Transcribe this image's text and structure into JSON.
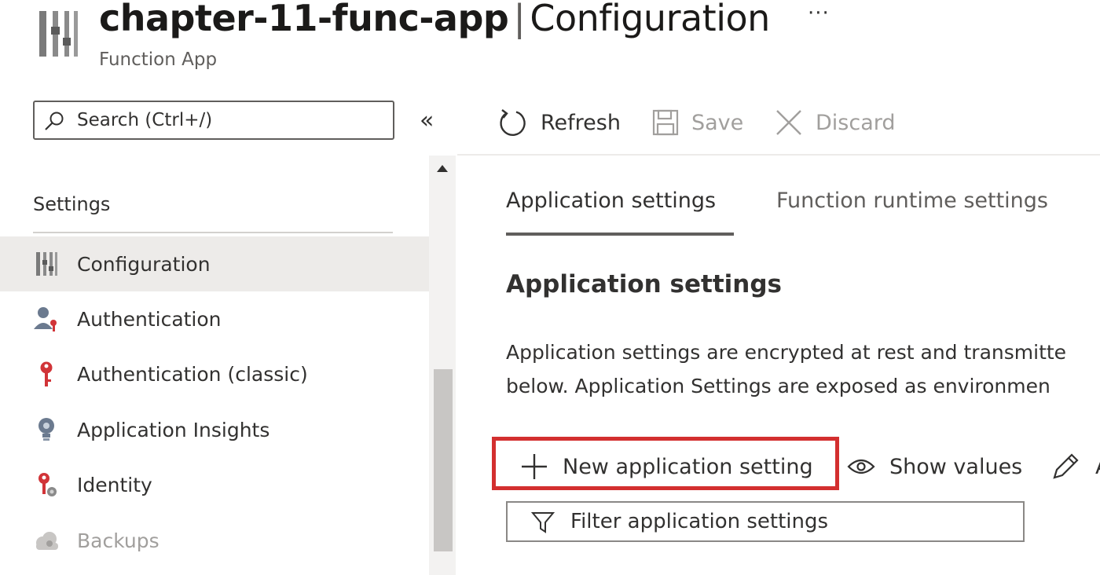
{
  "header": {
    "resource_name": "chapter-11-func-app",
    "separator": "|",
    "page_name": "Configuration",
    "more": "···",
    "subtitle": "Function App"
  },
  "search": {
    "placeholder": "Search (Ctrl+/)"
  },
  "collapse_label": "«",
  "toolbar": {
    "refresh_label": "Refresh",
    "save_label": "Save",
    "discard_label": "Discard"
  },
  "sidebar": {
    "group_label": "Settings",
    "items": [
      {
        "label": "Configuration",
        "icon": "sliders-icon",
        "selected": true
      },
      {
        "label": "Authentication",
        "icon": "user-key-icon"
      },
      {
        "label": "Authentication (classic)",
        "icon": "key-icon"
      },
      {
        "label": "Application Insights",
        "icon": "lightbulb-icon"
      },
      {
        "label": "Identity",
        "icon": "identity-key-icon"
      },
      {
        "label": "Backups",
        "icon": "cloud-icon",
        "disabled": true
      }
    ]
  },
  "tabs": [
    {
      "label": "Application settings",
      "active": true
    },
    {
      "label": "Function runtime settings"
    }
  ],
  "section": {
    "title": "Application settings",
    "description_line1": "Application settings are encrypted at rest and transmitte",
    "description_line2": "below. Application Settings are exposed as environmen"
  },
  "actions": {
    "new_label": "New application setting",
    "show_values_label": "Show values",
    "edit_label": "A"
  },
  "filter": {
    "placeholder": "Filter application settings"
  },
  "colors": {
    "highlight": "#d32f2f",
    "selected_bg": "#edebe9",
    "disabled_text": "#a19f9d",
    "text": "#323130"
  }
}
